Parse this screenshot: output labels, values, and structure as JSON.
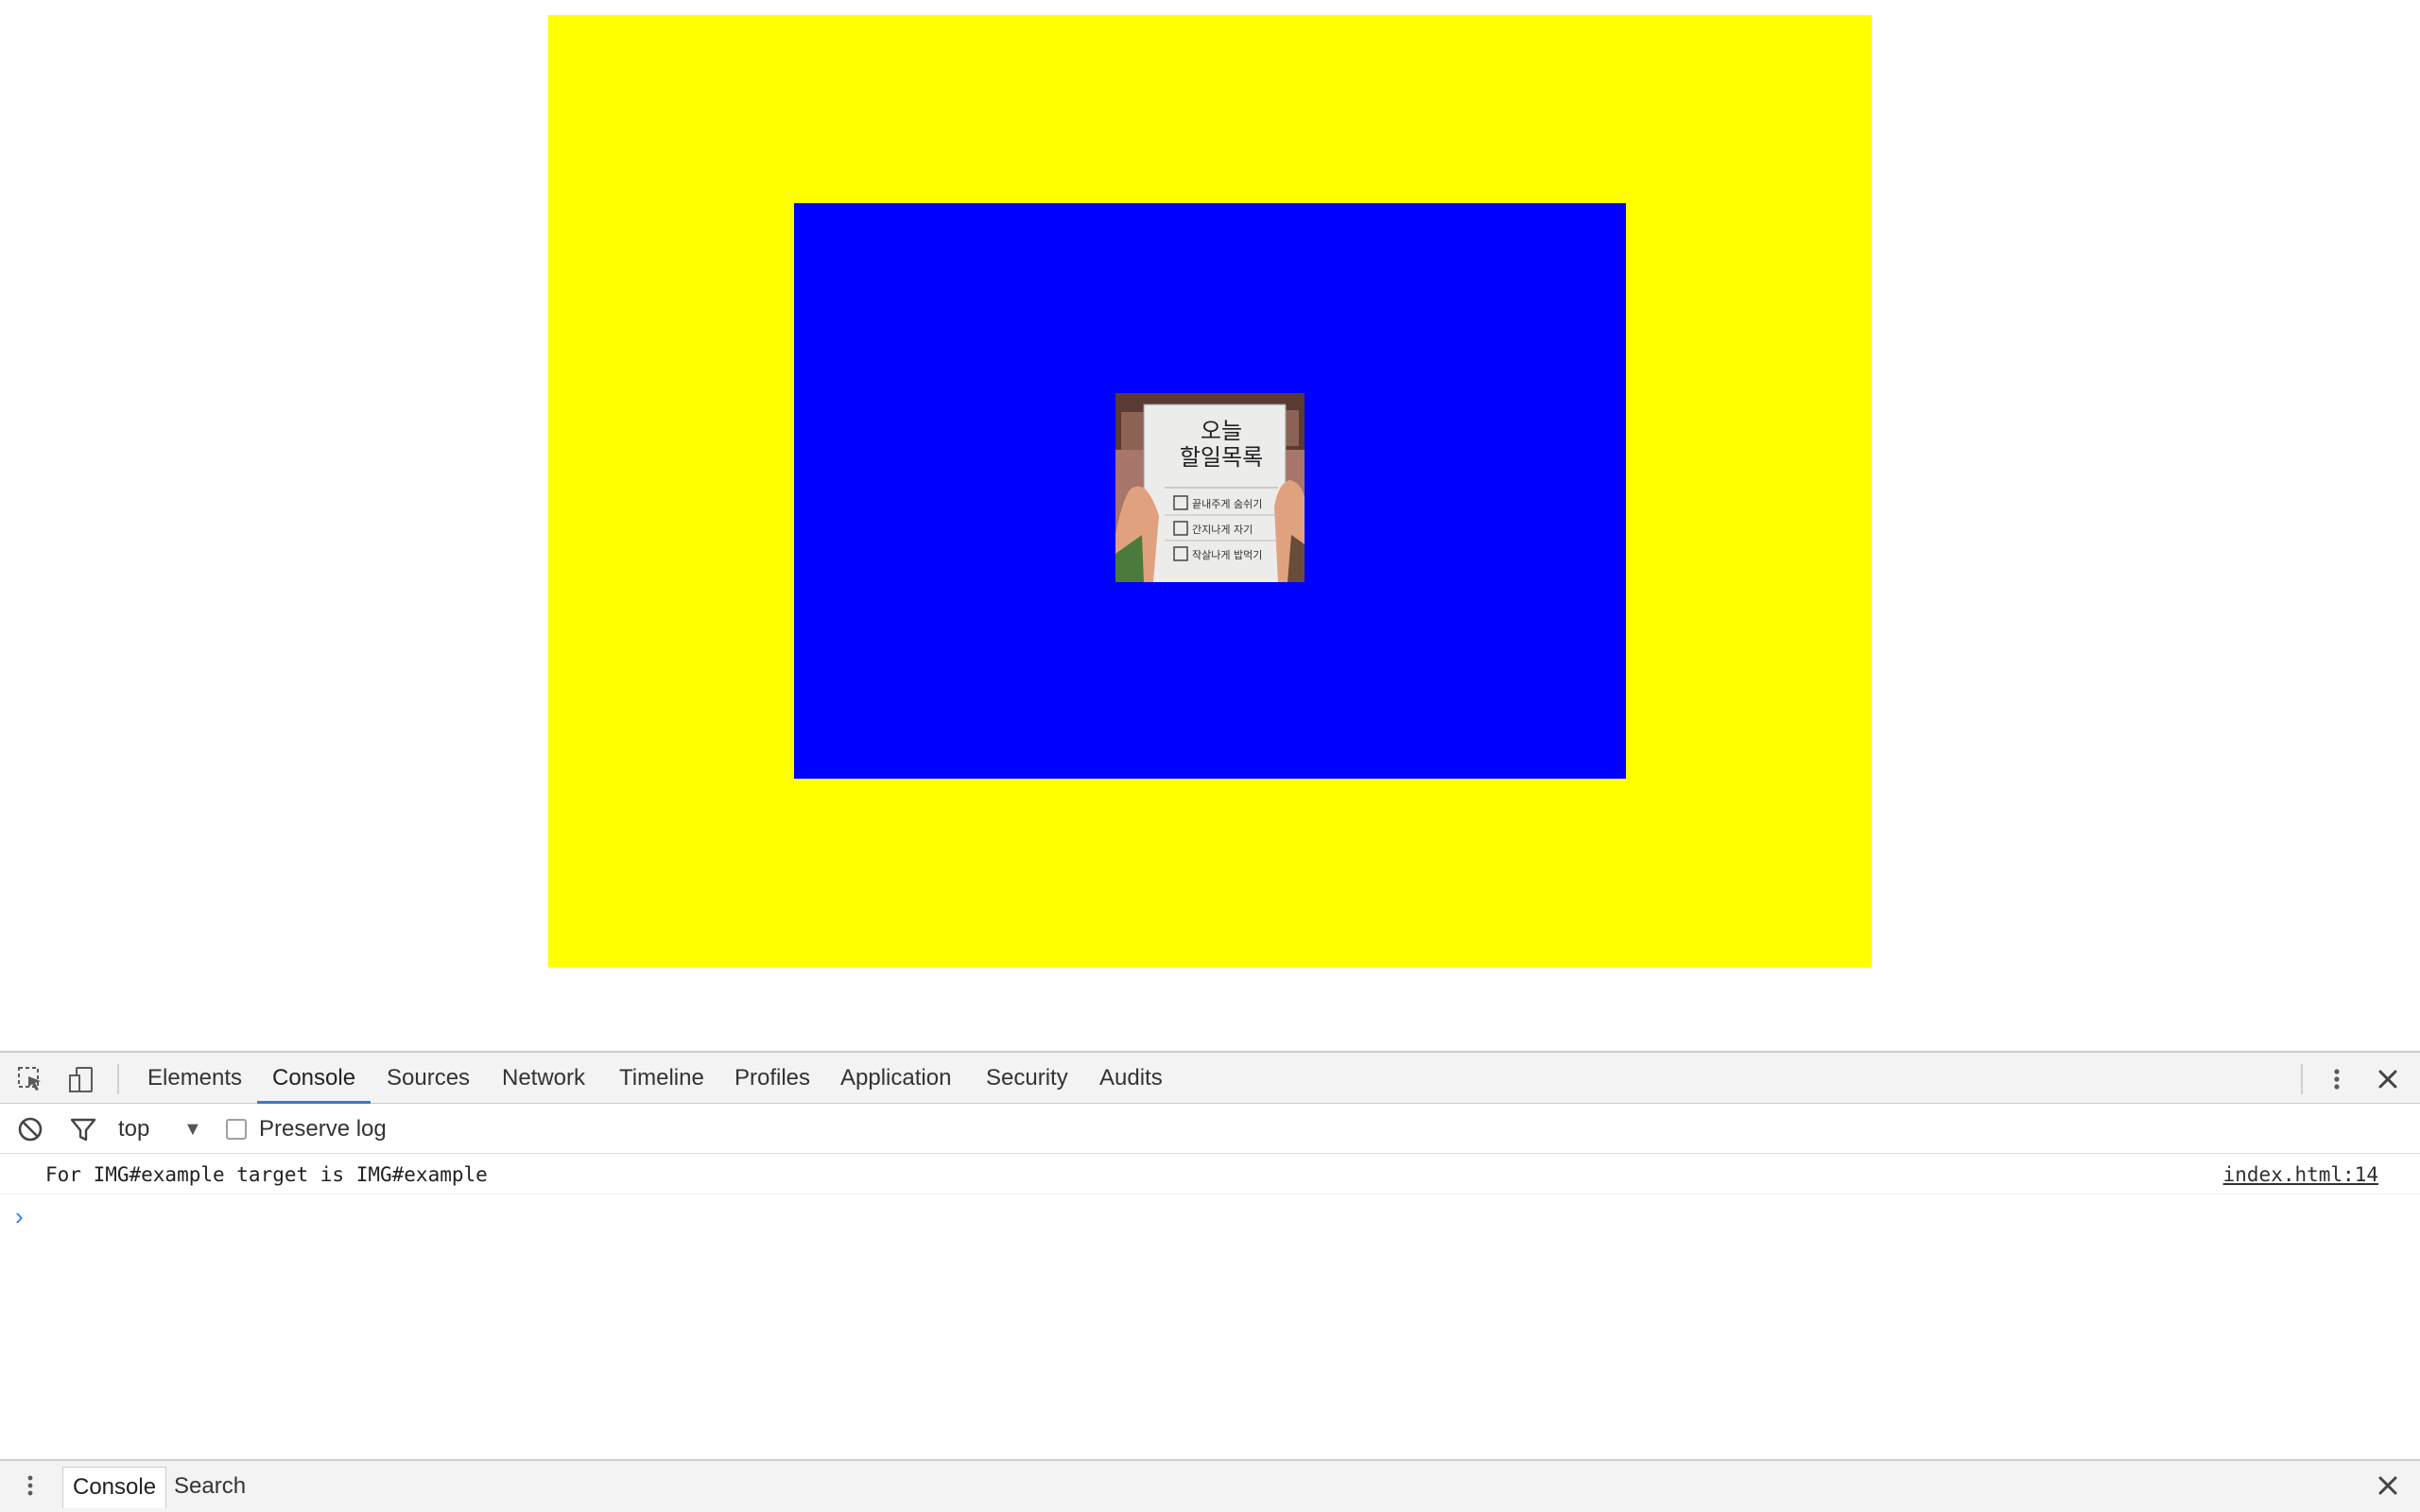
{
  "page": {
    "outer_color": "#ffff00",
    "inner_color": "#0000ff",
    "image": {
      "title_line1": "오늘",
      "title_line2": "할일목록",
      "items": [
        "끝내주게 숨쉬기",
        "간지나게 자기",
        "작살나게 밥먹기"
      ]
    }
  },
  "devtools": {
    "inspect_icon": "inspect-element-icon",
    "device_icon": "device-toolbar-icon",
    "tabs": [
      {
        "label": "Elements"
      },
      {
        "label": "Console"
      },
      {
        "label": "Sources"
      },
      {
        "label": "Network"
      },
      {
        "label": "Timeline"
      },
      {
        "label": "Profiles"
      },
      {
        "label": "Application"
      },
      {
        "label": "Security"
      },
      {
        "label": "Audits"
      }
    ],
    "active_tab": "Console",
    "menu_icon": "more-vert-icon",
    "close_icon": "close-icon",
    "toolbar": {
      "clear_icon": "clear-console-icon",
      "filter_icon": "filter-icon",
      "context": "top",
      "context_arrow": "▼",
      "preserve_log_label": "Preserve log",
      "preserve_log_checked": false
    },
    "messages": [
      {
        "text": "For IMG#example target is IMG#example",
        "source": "index.html:14"
      }
    ],
    "prompt_symbol": "›",
    "accent_color": "#3879d9"
  },
  "drawer": {
    "menu_icon": "more-vert-icon",
    "tabs": [
      {
        "label": "Console"
      },
      {
        "label": "Search"
      }
    ],
    "active_tab": "Console",
    "close_icon": "close-icon"
  }
}
